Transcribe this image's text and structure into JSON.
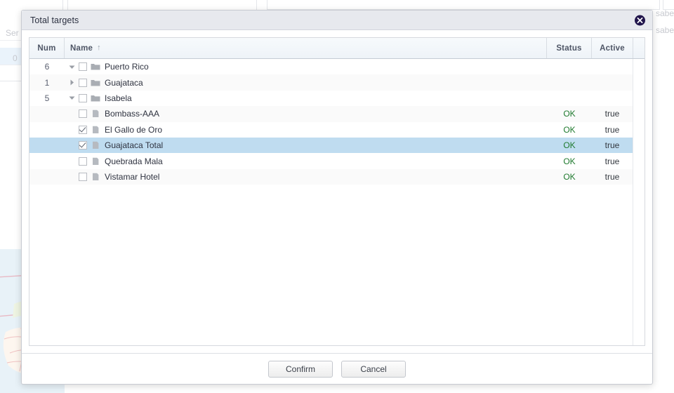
{
  "dialog": {
    "title": "Total targets",
    "close_icon": "close-circle-icon"
  },
  "grid": {
    "columns": [
      {
        "key": "num",
        "label": "Num",
        "sort": ""
      },
      {
        "key": "name",
        "label": "Name",
        "sort": "↑"
      },
      {
        "key": "status",
        "label": "Status",
        "sort": ""
      },
      {
        "key": "active",
        "label": "Active",
        "sort": ""
      }
    ],
    "rows": [
      {
        "num": "6",
        "name": "Puerto Rico",
        "status": "",
        "active": "",
        "level": 0,
        "type": "folder",
        "twisty": "expanded",
        "checked": false,
        "selected": false
      },
      {
        "num": "1",
        "name": "Guajataca",
        "status": "",
        "active": "",
        "level": 1,
        "type": "folder",
        "twisty": "collapsed",
        "checked": false,
        "selected": false
      },
      {
        "num": "5",
        "name": "Isabela",
        "status": "",
        "active": "",
        "level": 1,
        "type": "folder",
        "twisty": "expanded",
        "checked": false,
        "selected": false
      },
      {
        "num": "",
        "name": "Bombass-AAA",
        "status": "OK",
        "active": "true",
        "level": 2,
        "type": "file",
        "twisty": "none",
        "checked": false,
        "selected": false
      },
      {
        "num": "",
        "name": "El Gallo de Oro",
        "status": "OK",
        "active": "true",
        "level": 2,
        "type": "file",
        "twisty": "none",
        "checked": true,
        "selected": false
      },
      {
        "num": "",
        "name": "Guajataca Total",
        "status": "OK",
        "active": "true",
        "level": 2,
        "type": "file",
        "twisty": "none",
        "checked": true,
        "selected": true
      },
      {
        "num": "",
        "name": "Quebrada Mala",
        "status": "OK",
        "active": "true",
        "level": 2,
        "type": "file",
        "twisty": "none",
        "checked": false,
        "selected": false
      },
      {
        "num": "",
        "name": "Vistamar Hotel",
        "status": "OK",
        "active": "true",
        "level": 2,
        "type": "file",
        "twisty": "none",
        "checked": false,
        "selected": false
      }
    ]
  },
  "footer": {
    "confirm_label": "Confirm",
    "cancel_label": "Cancel"
  },
  "background": {
    "ser_label": "Ser",
    "zero_value": "0",
    "sabela_1": "sabela",
    "sabela_2": "sabela"
  },
  "colors": {
    "title_bar": "#e7e9ee",
    "selected_row": "#bfdcf0",
    "status_ok": "#1f7a2e",
    "close_button": "#21154c",
    "header": "#f0f5fa"
  }
}
